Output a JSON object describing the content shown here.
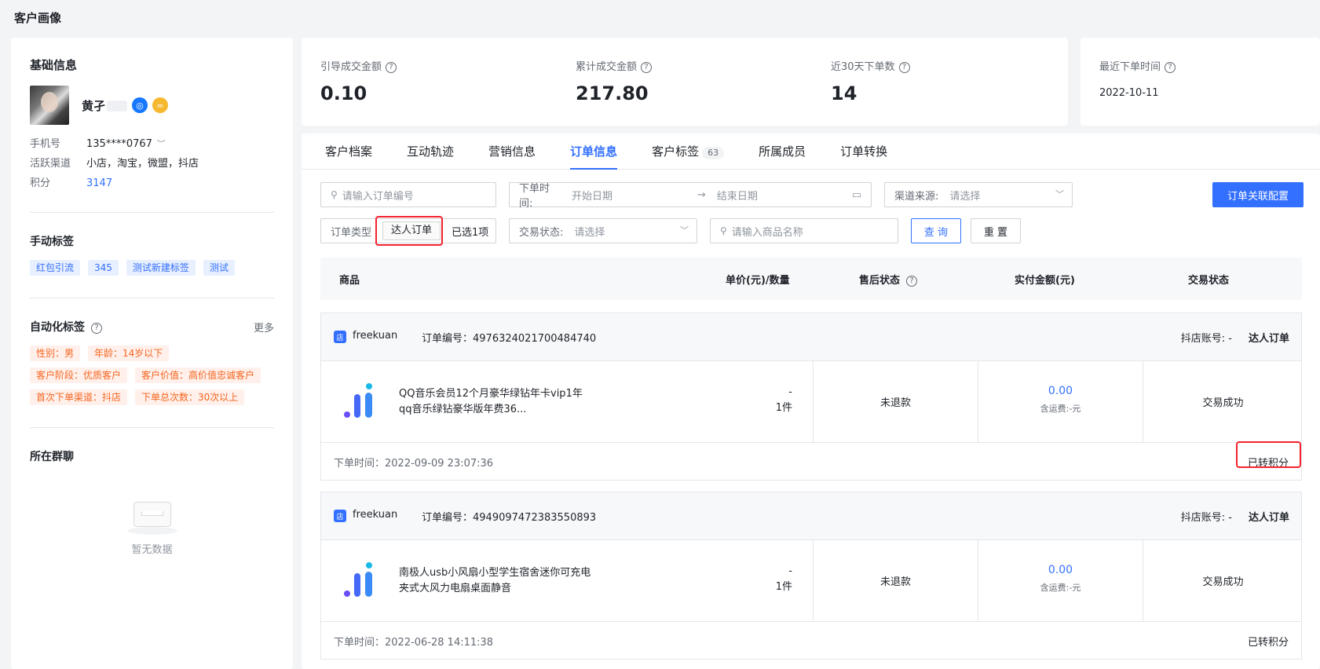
{
  "page_title": "客户画像",
  "basic": {
    "title": "基础信息",
    "name": "黄孑",
    "fields": [
      {
        "label": "手机号",
        "value": "135****0767"
      },
      {
        "label": "活跃渠道",
        "value": "小店，淘宝，微盟，抖店"
      },
      {
        "label": "积分",
        "value": "3147"
      }
    ]
  },
  "manual_tags": {
    "title": "手动标签",
    "items": [
      "红包引流",
      "345",
      "测试新建标签",
      "测试"
    ]
  },
  "auto_tags": {
    "title": "自动化标签",
    "more": "更多",
    "items": [
      "性别：男",
      "年龄：14岁以下",
      "客户阶段：优质客户",
      "客户价值：高价值忠诚客户",
      "首次下单渠道：抖店",
      "下单总次数：30次以上"
    ]
  },
  "groups": {
    "title": "所在群聊",
    "empty": "暂无数据"
  },
  "stats": [
    {
      "label": "引导成交金额",
      "value": "0.10"
    },
    {
      "label": "累计成交金额",
      "value": "217.80"
    },
    {
      "label": "近30天下单数",
      "value": "14"
    }
  ],
  "last_order": {
    "label": "最近下单时间",
    "value": "2022-10-11"
  },
  "tabs": [
    {
      "label": "客户档案"
    },
    {
      "label": "互动轨迹"
    },
    {
      "label": "营销信息"
    },
    {
      "label": "订单信息"
    },
    {
      "label": "客户标签",
      "count": "63"
    },
    {
      "label": "所属成员"
    },
    {
      "label": "订单转换"
    }
  ],
  "filters": {
    "order_no_placeholder": "请输入订单编号",
    "time_label": "下单时间:",
    "start_date": "开始日期",
    "end_date": "结束日期",
    "channel_label": "渠道来源:",
    "select_placeholder": "请选择",
    "config_button": "订单关联配置",
    "type_label": "订单类型",
    "type_chip": "达人订单",
    "type_selected": "已选1项",
    "status_label": "交易状态:",
    "product_placeholder": "请输入商品名称",
    "query_button": "查 询",
    "reset_button": "重 置"
  },
  "table_headers": [
    "商品",
    "单价(元)/数量",
    "售后状态",
    "实付金额(元)",
    "交易状态"
  ],
  "orders": [
    {
      "shop": "freekuan",
      "order_no": "订单编号：4976324021700484740",
      "account": "抖店账号: -",
      "type": "达人订单",
      "product": "QQ音乐会员12个月豪华绿钻年卡vip1年 qq音乐绿钻豪华版年费36...",
      "price": "-",
      "qty": "1件",
      "refund": "未退款",
      "amount": "0.00",
      "shipping": "含运费:-元",
      "status": "交易成功",
      "time": "下单时间：2022-09-09 23:07:36",
      "points": "已转积分"
    },
    {
      "shop": "freekuan",
      "order_no": "订单编号：4949097472383550893",
      "account": "抖店账号: -",
      "type": "达人订单",
      "product": "南极人usb小风扇小型学生宿舍迷你可充电夹式大风力电扇桌面静音",
      "price": "-",
      "qty": "1件",
      "refund": "未退款",
      "amount": "0.00",
      "shipping": "含运费:-元",
      "status": "交易成功",
      "time": "下单时间：2022-06-28 14:11:38",
      "points": "已转积分"
    }
  ],
  "colors": {
    "primary": "#3370ff",
    "highlight": "#f5222d",
    "tag_orange": "#f5651e"
  }
}
